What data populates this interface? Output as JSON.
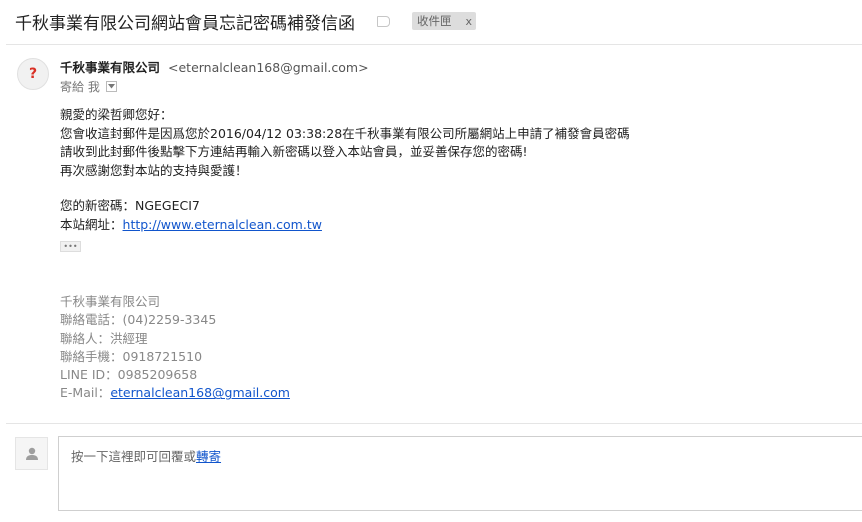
{
  "subject": "千秋事業有限公司網站會員忘記密碼補發信函",
  "label_chip": {
    "text": "收件匣",
    "remove": "x"
  },
  "sender": {
    "avatar_glyph": "?",
    "name": "千秋事業有限公司",
    "email": "<eternalclean168@gmail.com>",
    "to_label": "寄給 我"
  },
  "body": {
    "lines": [
      "親愛的梁哲卿您好：",
      "您會收這封郵件是因爲您於2016/04/12 03:38:28在千秋事業有限公司所屬網站上申請了補發會員密碼",
      "請收到此封郵件後點擊下方連結再輸入新密碼以登入本站會員，並妥善保存您的密碼!",
      "再次感謝您對本站的支持與愛護！"
    ],
    "password_line": "您的新密碼：NGEGECI7",
    "site_label": "本站網址：",
    "site_url": "http://www.eternalclean.com.tw",
    "ellipsis": "•••"
  },
  "signature": {
    "company": "千秋事業有限公司",
    "phone": "聯絡電話：(04)2259-3345",
    "contact": "聯絡人：洪經理",
    "mobile": "聯絡手機：0918721510",
    "line_id": "LINE ID：0985209658",
    "email_label": "E-Mail：",
    "email": "eternalclean168@gmail.com"
  },
  "reply": {
    "prompt_prefix": "按一下這裡即可回覆或",
    "forward_link": "轉寄"
  },
  "icons": {
    "label_marker": "label-icon",
    "dropdown": "chevron-down-icon",
    "reply_avatar": "person-icon"
  },
  "colors": {
    "link": "#1155cc",
    "avatar_question": "#d93025",
    "signature_text": "#888888"
  }
}
